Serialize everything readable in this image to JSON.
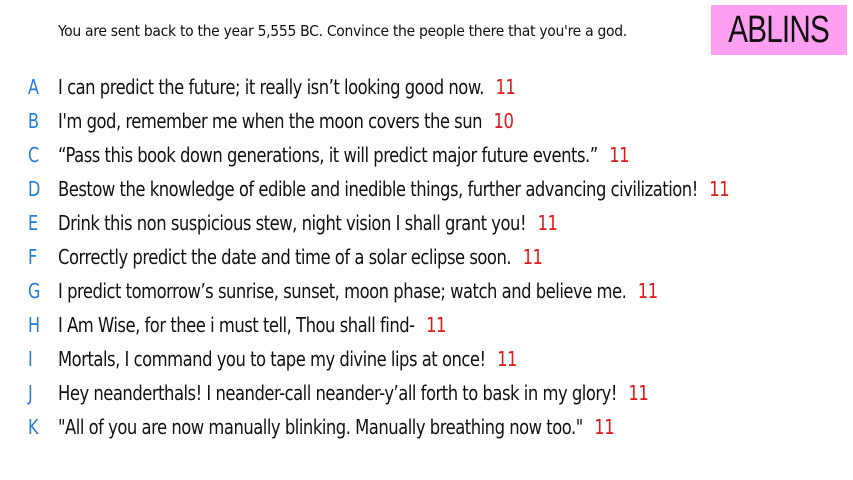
{
  "title": "ABLINS",
  "prompt": "You are sent back to the year 5,555 BC. Convince the people there that you're a god.",
  "colors": {
    "title_badge": "#ff9ff2",
    "letter": "#1f7be0",
    "score": "#e01818",
    "text": "#111111"
  },
  "answers": [
    {
      "letter": "A",
      "text": "I can predict the future; it really isn’t looking good now.",
      "score": "11"
    },
    {
      "letter": "B",
      "text": "I'm god, remember me when the moon covers the sun",
      "score": "10"
    },
    {
      "letter": "C",
      "text": "“Pass this book down generations, it will predict major future events.”",
      "score": "11"
    },
    {
      "letter": "D",
      "text": "Bestow the knowledge of edible and inedible things, further advancing civilization!",
      "score": "11"
    },
    {
      "letter": "E",
      "text": "Drink this non suspicious stew, night vision I shall grant you!",
      "score": "11"
    },
    {
      "letter": "F",
      "text": "Correctly predict the date and time of a solar eclipse soon.",
      "score": "11"
    },
    {
      "letter": "G",
      "text": "I predict tomorrow’s sunrise, sunset, moon phase; watch and believe me.",
      "score": "11"
    },
    {
      "letter": "H",
      "text": "I Am Wise, for thee i must tell, Thou shall find-",
      "score": "11"
    },
    {
      "letter": "I",
      "text": "Mortals, I command you to tape my divine lips at once!",
      "score": "11"
    },
    {
      "letter": "J",
      "text": "Hey neanderthals! I neander-call neander-y’all forth to bask in my glory!",
      "score": "11"
    },
    {
      "letter": "K",
      "text": "\"All of you are now manually blinking. Manually breathing now too.\"",
      "score": "11"
    }
  ]
}
